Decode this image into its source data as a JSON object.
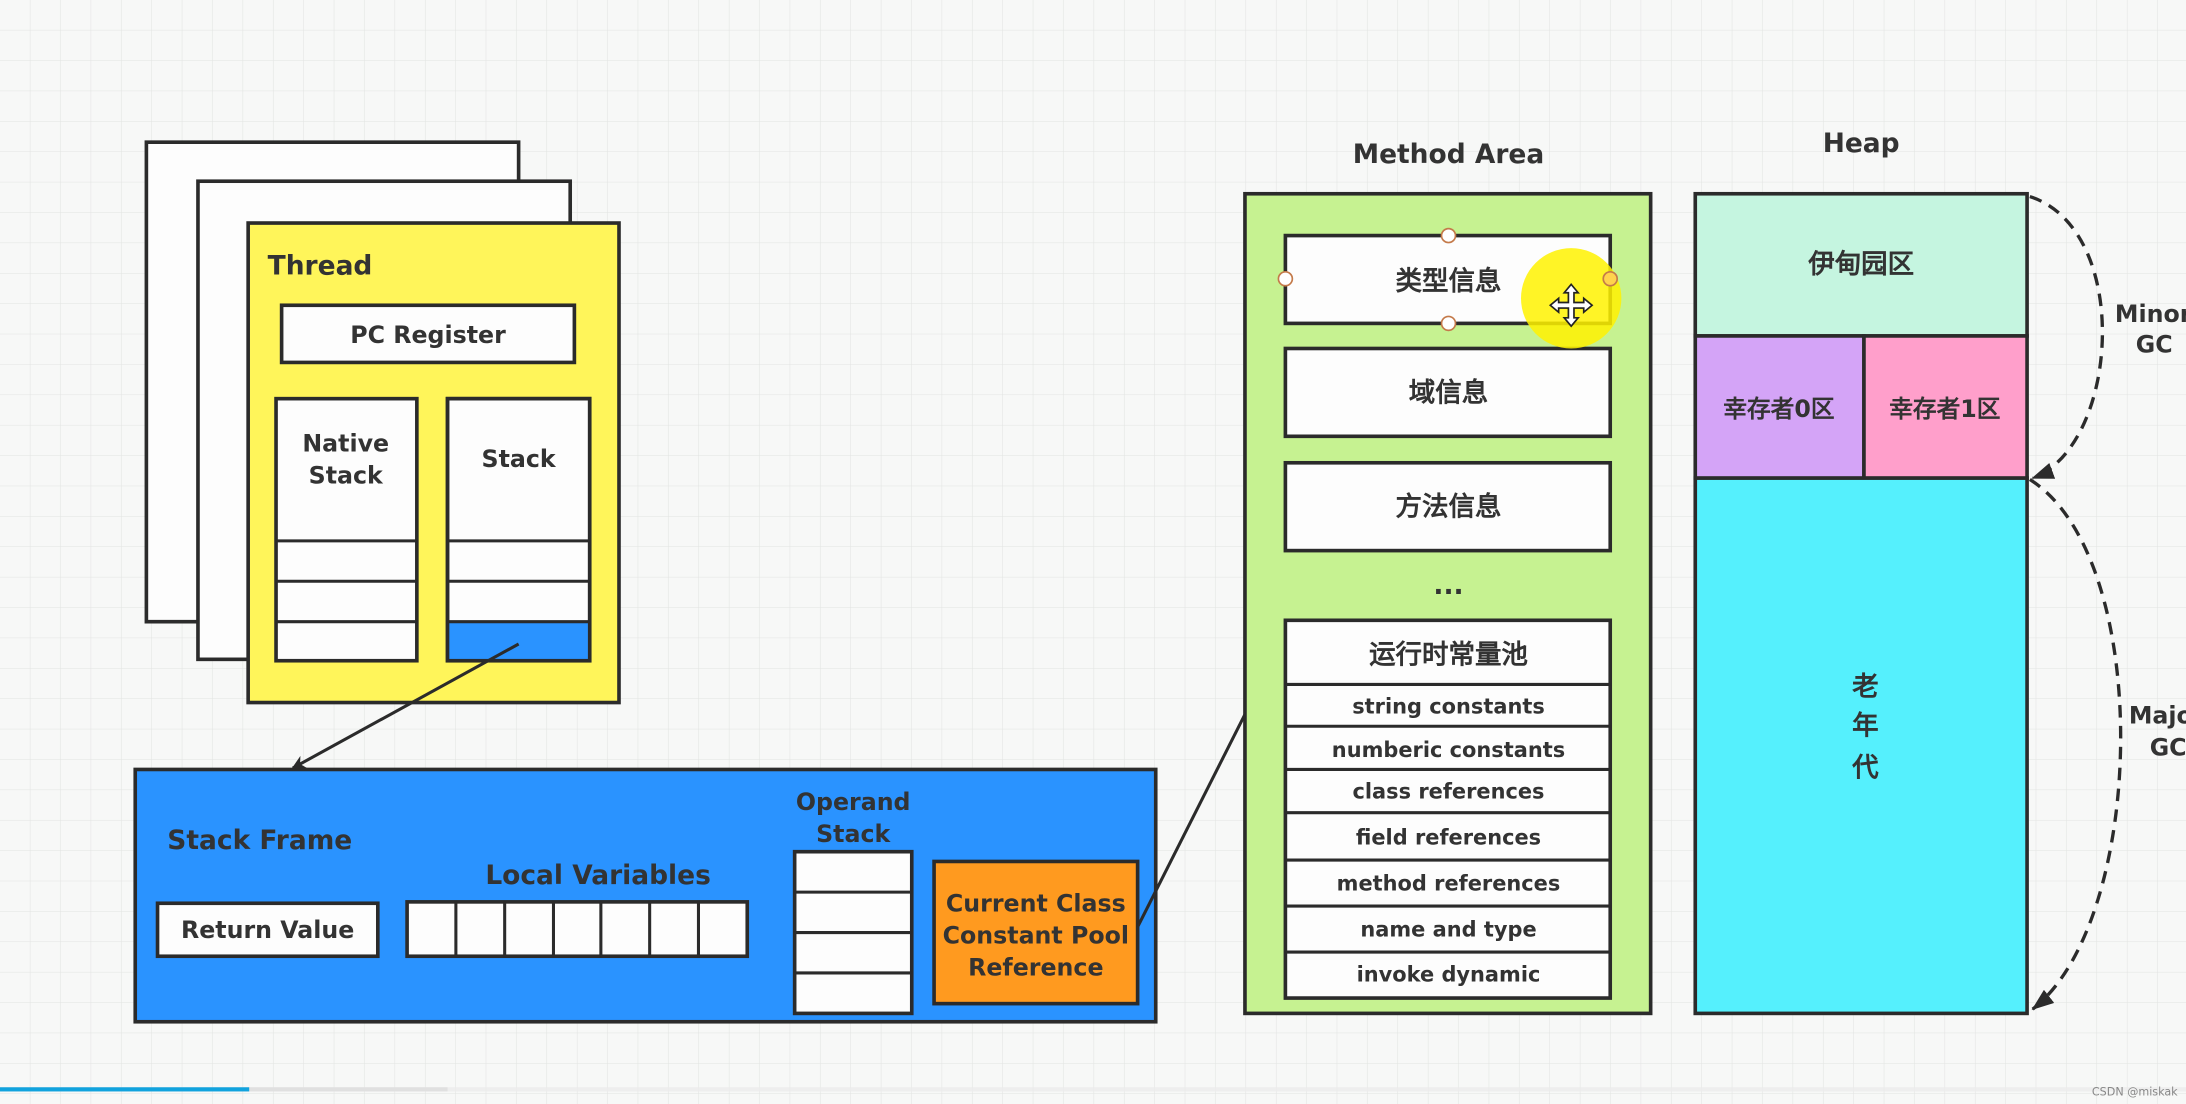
{
  "thread": {
    "title": "Thread",
    "pc_register": "PC Register",
    "native_stack": [
      "Native",
      "Stack"
    ],
    "stack": "Stack"
  },
  "stack_frame": {
    "title": "Stack Frame",
    "return_value": "Return Value",
    "local_variables": "Local Variables",
    "operand_stack": [
      "Operand",
      "Stack"
    ],
    "constant_pool_ref": [
      "Current Class",
      "Constant Pool",
      "Reference"
    ]
  },
  "method_area": {
    "title": "Method Area",
    "type_info": "类型信息",
    "field_info": "域信息",
    "method_info": "方法信息",
    "ellipsis": "...",
    "runtime_constant_pool": "运行时常量池",
    "pool_items": [
      "string constants",
      "numberic constants",
      "class references",
      "field references",
      "method references",
      "name and type",
      "invoke dynamic"
    ]
  },
  "heap": {
    "title": "Heap",
    "eden": "伊甸园区",
    "survivor0": "幸存者0区",
    "survivor1": "幸存者1区",
    "old_gen": [
      "老",
      "年",
      "代"
    ],
    "minor_gc": [
      "Minor",
      "GC"
    ],
    "major_gc": [
      "Major",
      "GC"
    ]
  },
  "colors": {
    "thread": "#fff55a",
    "stack_frame": "#2a93ff",
    "constant_pool_ref": "#ff9a1f",
    "method_area": "#c6f291",
    "eden": "#c5f5e0",
    "survivor0": "#d4a4f7",
    "survivor1": "#ff9fcb",
    "old_gen": "#55f0fd",
    "cursor_highlight": "#fff200"
  },
  "video_progress_percent": 11.4,
  "watermark": "CSDN @miskak"
}
